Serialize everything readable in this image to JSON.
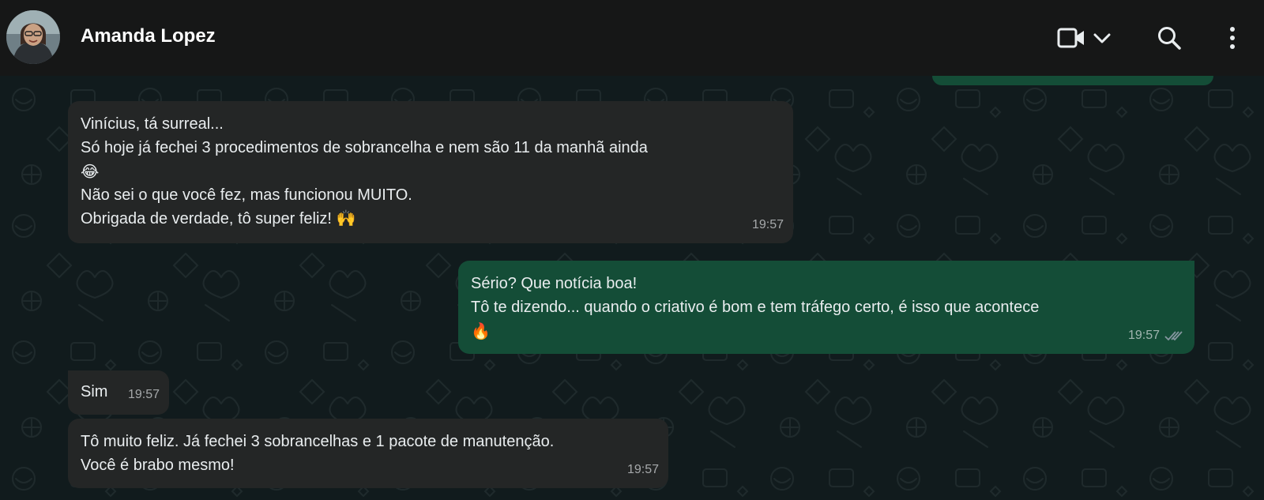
{
  "header": {
    "contact_name": "Amanda Lopez"
  },
  "icons": {
    "video": "video-camera-icon",
    "chevron": "chevron-down-icon",
    "search": "search-icon",
    "menu": "kebab-menu-icon",
    "read": "double-check-icon"
  },
  "colors": {
    "incoming_bubble": "#242626",
    "outgoing_bubble": "#144d37",
    "read_tick": "#8696a0"
  },
  "messages": [
    {
      "direction": "incoming",
      "lines": [
        "Vinícius, tá surreal...",
        "Só hoje já fechei 3 procedimentos de sobrancelha e nem são 11 da manhã ainda",
        "😂",
        "Não sei o que você fez, mas funcionou MUITO.",
        "Obrigada de verdade, tô super feliz! 🙌"
      ],
      "time": "19:57"
    },
    {
      "direction": "outgoing",
      "lines": [
        "Sério? Que notícia boa!",
        "Tô te dizendo... quando o criativo é bom e tem tráfego certo, é isso que acontece",
        "🔥"
      ],
      "time": "19:57",
      "status": "read"
    },
    {
      "direction": "incoming",
      "lines": [
        "Sim"
      ],
      "time": "19:57"
    },
    {
      "direction": "incoming",
      "lines": [
        "Tô muito feliz. Já fechei 3 sobrancelhas e 1 pacote de manutenção.",
        "Você é brabo mesmo!"
      ],
      "time": "19:57"
    }
  ]
}
